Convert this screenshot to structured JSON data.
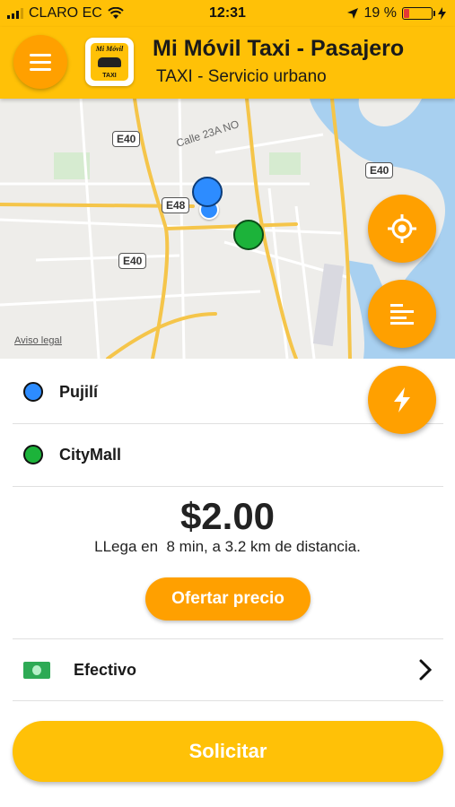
{
  "status_bar": {
    "carrier": "CLARO EC",
    "time": "12:31",
    "battery_percent": "19 %",
    "battery_level": 0.19
  },
  "header": {
    "title": "Mi Móvil Taxi - Pasajero",
    "subtitle": "TAXI - Servicio urbano",
    "logo_top": "Mi Móvil",
    "logo_bottom": "TAXI"
  },
  "map": {
    "shields": [
      "E40",
      "E40",
      "E48",
      "E40"
    ],
    "street": "Calle 23A NO",
    "legal": "Aviso legal"
  },
  "trip": {
    "origin": "Pujilí",
    "destination": "CityMall",
    "price": "$2.00",
    "eta": "LLega en  8 min, a 3.2 km de distancia.",
    "offer_button": "Ofertar precio"
  },
  "payment": {
    "method": "Efectivo"
  },
  "request_button": "Solicitar",
  "colors": {
    "primary": "#FFC107",
    "accent": "#FFA000",
    "origin": "#2D8CFF",
    "destination": "#1CB33A",
    "water": "#A8D0F0"
  }
}
